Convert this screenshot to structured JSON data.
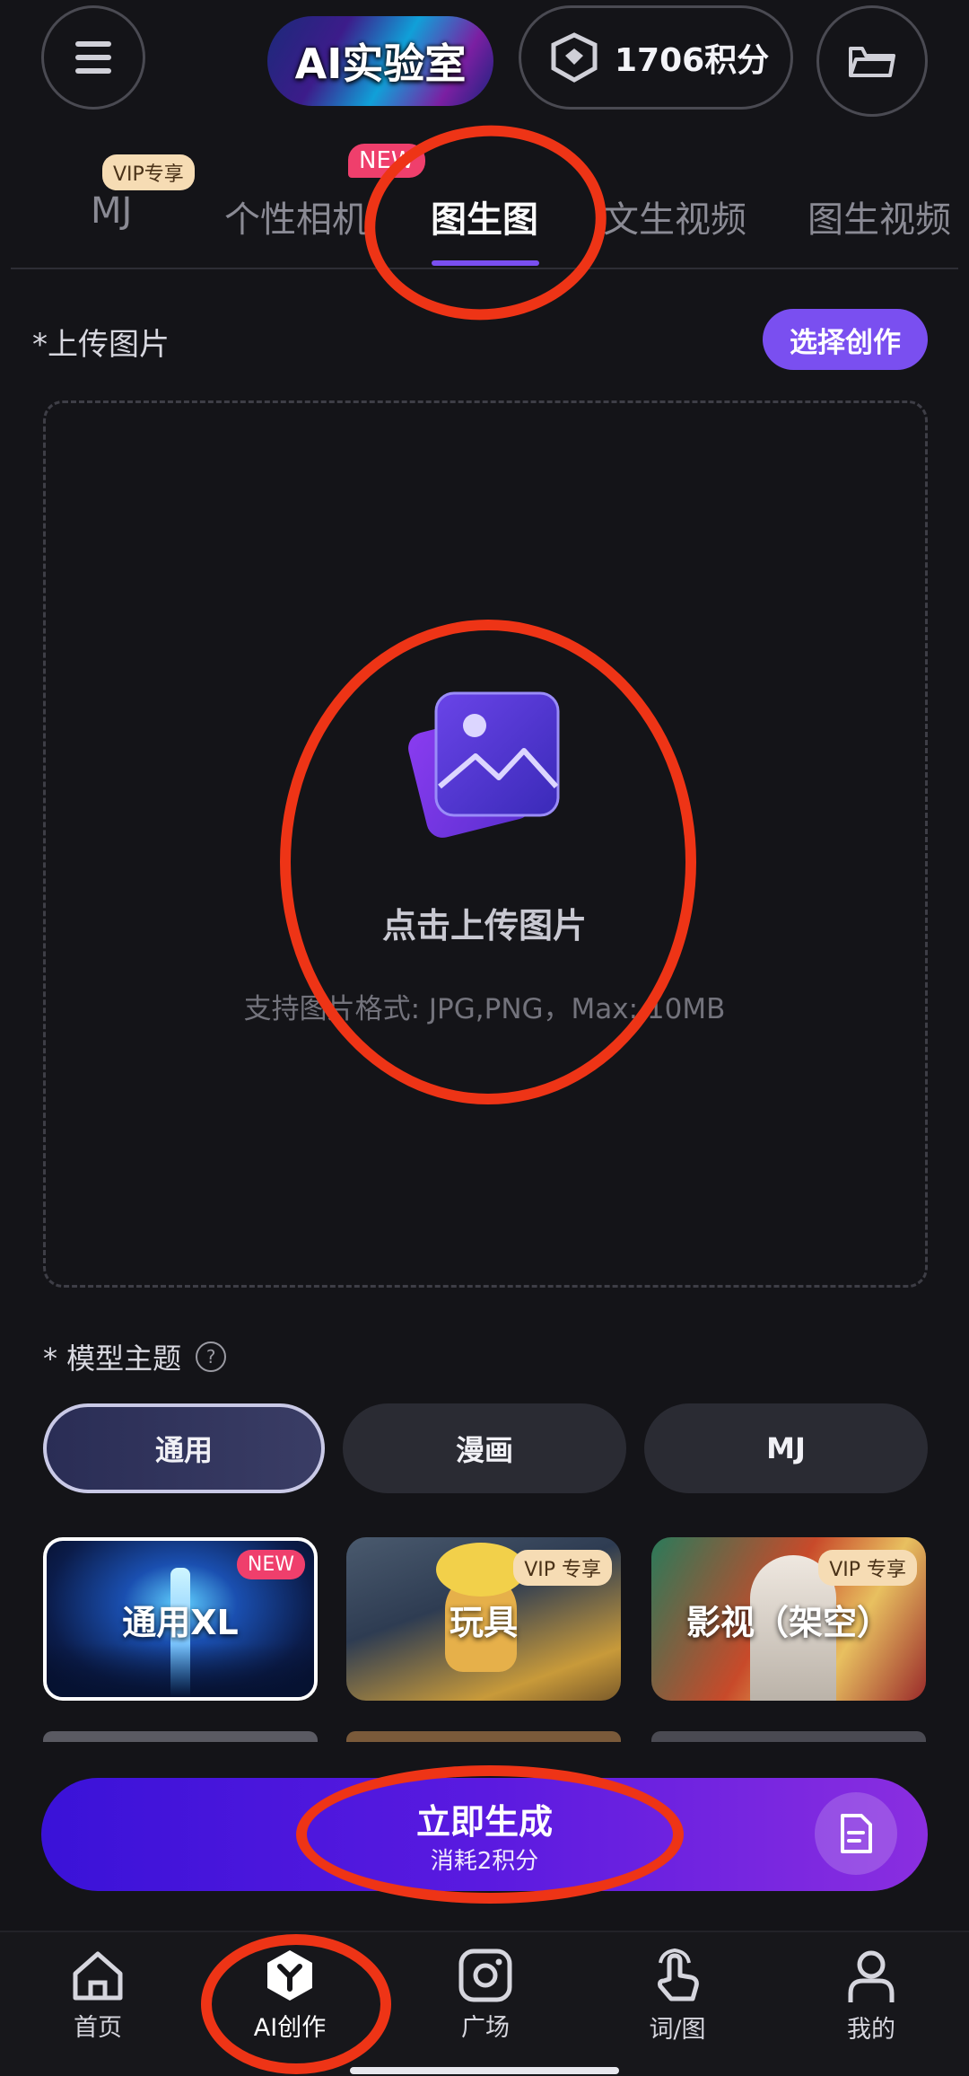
{
  "header": {
    "logo_text": "AI实验室",
    "points_label": "1706积分"
  },
  "tabs": [
    {
      "label": "MJ",
      "badge": "VIP专享"
    },
    {
      "label": "个性相机",
      "badge": "NEW"
    },
    {
      "label": "图生图"
    },
    {
      "label": "文生视频"
    },
    {
      "label": "图生视频"
    }
  ],
  "upload": {
    "section_label": "*上传图片",
    "choose_button": "选择创作",
    "prompt": "点击上传图片",
    "hint": "支持图片格式: JPG,PNG，Max: 10MB"
  },
  "model_theme": {
    "label": "* 模型主题",
    "help_icon": "?",
    "options": [
      "通用",
      "漫画",
      "MJ"
    ],
    "selected": "通用"
  },
  "model_cards": [
    {
      "label": "通用XL",
      "badge": "NEW"
    },
    {
      "label": "玩具",
      "badge": "VIP 专享"
    },
    {
      "label": "影视（架空）",
      "badge": "VIP 专享"
    }
  ],
  "generate": {
    "title": "立即生成",
    "subtitle": "消耗2积分"
  },
  "bottom_nav": [
    {
      "label": "首页",
      "icon": "home-icon"
    },
    {
      "label": "AI创作",
      "icon": "ai-create-icon"
    },
    {
      "label": "广场",
      "icon": "square-icon"
    },
    {
      "label": "词/图",
      "icon": "touch-icon"
    },
    {
      "label": "我的",
      "icon": "profile-icon"
    }
  ],
  "colors": {
    "background": "#141418",
    "accent": "#7a4ff0",
    "annotation": "#ee3416"
  }
}
